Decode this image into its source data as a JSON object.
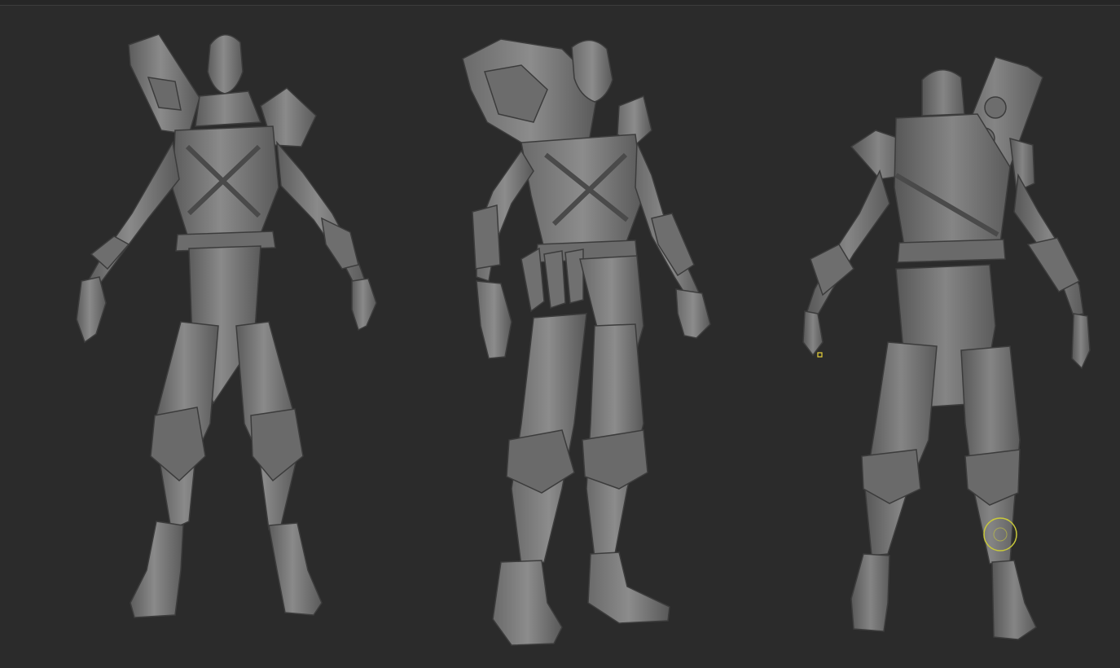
{
  "app": {
    "title": "",
    "background_color": "#2b2b2b",
    "top_border_color": "#3c3c3c"
  },
  "viewport": {
    "figures": [
      {
        "name": "front-view",
        "shade": "#777777"
      },
      {
        "name": "three-quarter-view",
        "shade": "#7a7a7a"
      },
      {
        "name": "back-view",
        "shade": "#767676"
      }
    ],
    "brush_cursor": {
      "color": "#c9c93a"
    },
    "pivot_marker": {
      "color": "#e8d23a"
    }
  }
}
